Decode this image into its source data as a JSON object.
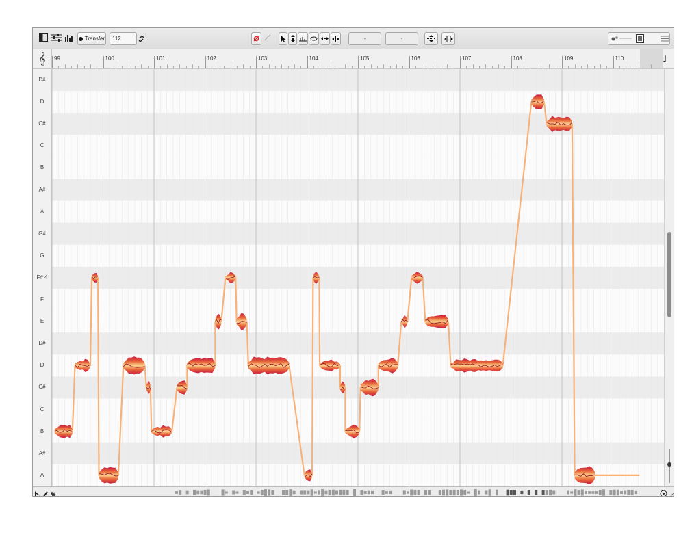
{
  "toolbar": {
    "transfer_label": "Transfer",
    "tempo_value": "112",
    "pitch_dropdown_value": "-",
    "time_dropdown_value": "-"
  },
  "ruler": {
    "bars": [
      "99",
      "100",
      "101",
      "102",
      "103",
      "104",
      "105",
      "106",
      "107",
      "108",
      "109",
      "110"
    ]
  },
  "pitch_keys": [
    {
      "name": "D#",
      "sharp": true
    },
    {
      "name": "D",
      "sharp": false
    },
    {
      "name": "C#",
      "sharp": true
    },
    {
      "name": "C",
      "sharp": false
    },
    {
      "name": "B",
      "sharp": false
    },
    {
      "name": "A#",
      "sharp": true
    },
    {
      "name": "A",
      "sharp": false
    },
    {
      "name": "G#",
      "sharp": true
    },
    {
      "name": "G",
      "sharp": false
    },
    {
      "name": "F# 4",
      "sharp": true
    },
    {
      "name": "F",
      "sharp": false
    },
    {
      "name": "E",
      "sharp": false
    },
    {
      "name": "D#",
      "sharp": true
    },
    {
      "name": "D",
      "sharp": false
    },
    {
      "name": "C#",
      "sharp": true
    },
    {
      "name": "C",
      "sharp": false
    },
    {
      "name": "B",
      "sharp": false
    },
    {
      "name": "A#",
      "sharp": true
    },
    {
      "name": "A",
      "sharp": false
    }
  ],
  "notes": [
    {
      "bar": 99.05,
      "len": 0.35,
      "pitch": "B"
    },
    {
      "bar": 99.45,
      "len": 0.3,
      "pitch": "D"
    },
    {
      "bar": 99.78,
      "len": 0.12,
      "pitch": "F# 4"
    },
    {
      "bar": 99.92,
      "len": 0.38,
      "pitch": "A"
    },
    {
      "bar": 100.4,
      "len": 0.42,
      "pitch": "D"
    },
    {
      "bar": 100.85,
      "len": 0.08,
      "pitch": "C#"
    },
    {
      "bar": 100.95,
      "len": 0.4,
      "pitch": "B"
    },
    {
      "bar": 101.45,
      "len": 0.2,
      "pitch": "C#"
    },
    {
      "bar": 101.65,
      "len": 0.55,
      "pitch": "D"
    },
    {
      "bar": 102.2,
      "len": 0.12,
      "pitch": "E"
    },
    {
      "bar": 102.4,
      "len": 0.2,
      "pitch": "F# 4"
    },
    {
      "bar": 102.62,
      "len": 0.2,
      "pitch": "E"
    },
    {
      "bar": 102.85,
      "len": 0.8,
      "pitch": "D"
    },
    {
      "bar": 103.95,
      "len": 0.15,
      "pitch": "A"
    },
    {
      "bar": 104.12,
      "len": 0.12,
      "pitch": "F# 4"
    },
    {
      "bar": 104.25,
      "len": 0.4,
      "pitch": "D"
    },
    {
      "bar": 104.65,
      "len": 0.1,
      "pitch": "C#"
    },
    {
      "bar": 104.75,
      "len": 0.28,
      "pitch": "B"
    },
    {
      "bar": 105.05,
      "len": 0.35,
      "pitch": "C#"
    },
    {
      "bar": 105.4,
      "len": 0.38,
      "pitch": "D"
    },
    {
      "bar": 105.85,
      "len": 0.12,
      "pitch": "E"
    },
    {
      "bar": 106.05,
      "len": 0.22,
      "pitch": "F# 4"
    },
    {
      "bar": 106.32,
      "len": 0.45,
      "pitch": "E"
    },
    {
      "bar": 106.82,
      "len": 1.02,
      "pitch": "D"
    },
    {
      "bar": 108.4,
      "len": 0.25,
      "pitch": "D"
    },
    {
      "bar": 108.7,
      "len": 0.5,
      "pitch": "C#"
    },
    {
      "bar": 109.25,
      "len": 0.4,
      "pitch": "A"
    }
  ]
}
